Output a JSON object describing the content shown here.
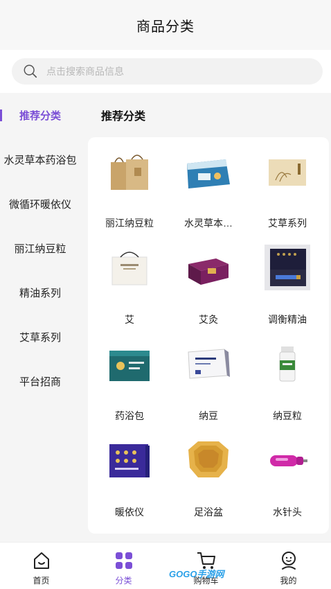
{
  "header": {
    "title": "商品分类"
  },
  "search": {
    "placeholder": "点击搜索商品信息",
    "icon": "search-icon"
  },
  "sidebar": {
    "items": [
      {
        "label": "推荐分类",
        "active": true
      },
      {
        "label": "水灵草本药浴包",
        "active": false
      },
      {
        "label": "微循环暖依仪",
        "active": false
      },
      {
        "label": "丽江纳豆粒",
        "active": false
      },
      {
        "label": "精油系列",
        "active": false
      },
      {
        "label": "艾草系列",
        "active": false
      },
      {
        "label": "平台招商",
        "active": false
      }
    ]
  },
  "main": {
    "section_title": "推荐分类",
    "products": [
      {
        "label": "丽江纳豆粒",
        "icon": "gift-bag-product-image"
      },
      {
        "label": "水灵草本…",
        "icon": "herbal-pack-product-image"
      },
      {
        "label": "艾草系列",
        "icon": "mugwort-box-product-image"
      },
      {
        "label": "艾",
        "icon": "white-bag-product-image"
      },
      {
        "label": "艾灸",
        "icon": "moxibustion-box-product-image"
      },
      {
        "label": "调衡精油",
        "icon": "essential-oil-product-image"
      },
      {
        "label": "药浴包",
        "icon": "bath-pack-product-image"
      },
      {
        "label": "纳豆",
        "icon": "natto-box-product-image"
      },
      {
        "label": "纳豆粒",
        "icon": "natto-bottle-product-image"
      },
      {
        "label": "暖依仪",
        "icon": "warming-device-product-image"
      },
      {
        "label": "足浴盆",
        "icon": "foot-basin-product-image"
      },
      {
        "label": "水针头",
        "icon": "water-needle-product-image"
      }
    ]
  },
  "tabbar": {
    "tabs": [
      {
        "label": "首页",
        "icon": "home-icon",
        "active": false
      },
      {
        "label": "分类",
        "icon": "category-icon",
        "active": true
      },
      {
        "label": "购物车",
        "icon": "cart-icon",
        "active": false
      },
      {
        "label": "我的",
        "icon": "profile-icon",
        "active": false
      }
    ]
  },
  "watermark": {
    "text": "GOGO手游网"
  },
  "colors": {
    "accent": "#7b4fd6",
    "background": "#f5f5f5",
    "panel": "#ffffff"
  }
}
